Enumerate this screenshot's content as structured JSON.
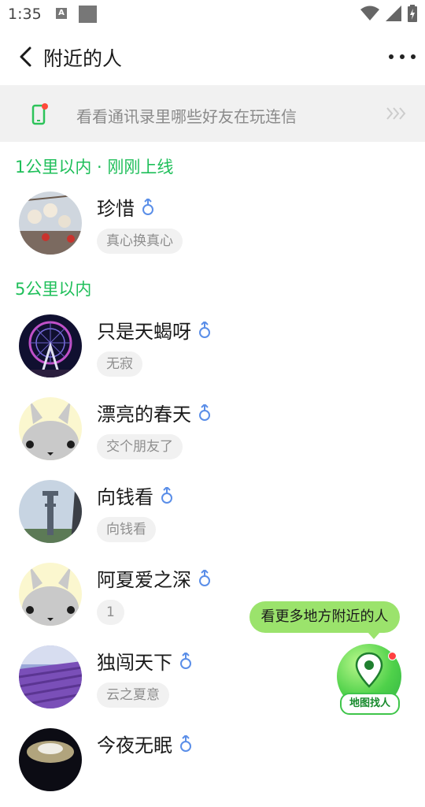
{
  "status": {
    "time": "1:35",
    "a_badge": "A"
  },
  "header": {
    "title": "附近的人"
  },
  "banner": {
    "text": "看看通讯录里哪些好友在玩连信"
  },
  "sections": [
    {
      "title": "1公里以内 · 刚刚上线"
    },
    {
      "title": "5公里以内"
    }
  ],
  "people": [
    {
      "name": "珍惜",
      "tag": "真心换真心",
      "gender": "male"
    },
    {
      "name": "只是天蝎呀",
      "tag": "无寂",
      "gender": "male"
    },
    {
      "name": "漂亮的春天",
      "tag": "交个朋友了",
      "gender": "male"
    },
    {
      "name": "向钱看",
      "tag": "向钱看",
      "gender": "male"
    },
    {
      "name": "阿夏爱之深",
      "tag": "1",
      "gender": "male"
    },
    {
      "name": "独闯天下",
      "tag": "云之夏意",
      "gender": "male"
    },
    {
      "name": "今夜无眠",
      "tag": "",
      "gender": "male"
    }
  ],
  "floating": {
    "bubble": "看更多地方附近的人",
    "map_label": "地图找人"
  },
  "colors": {
    "accent_green": "#1fbf5a",
    "gender_blue": "#5a8ee8",
    "banner_bg": "#f1f1f1"
  }
}
